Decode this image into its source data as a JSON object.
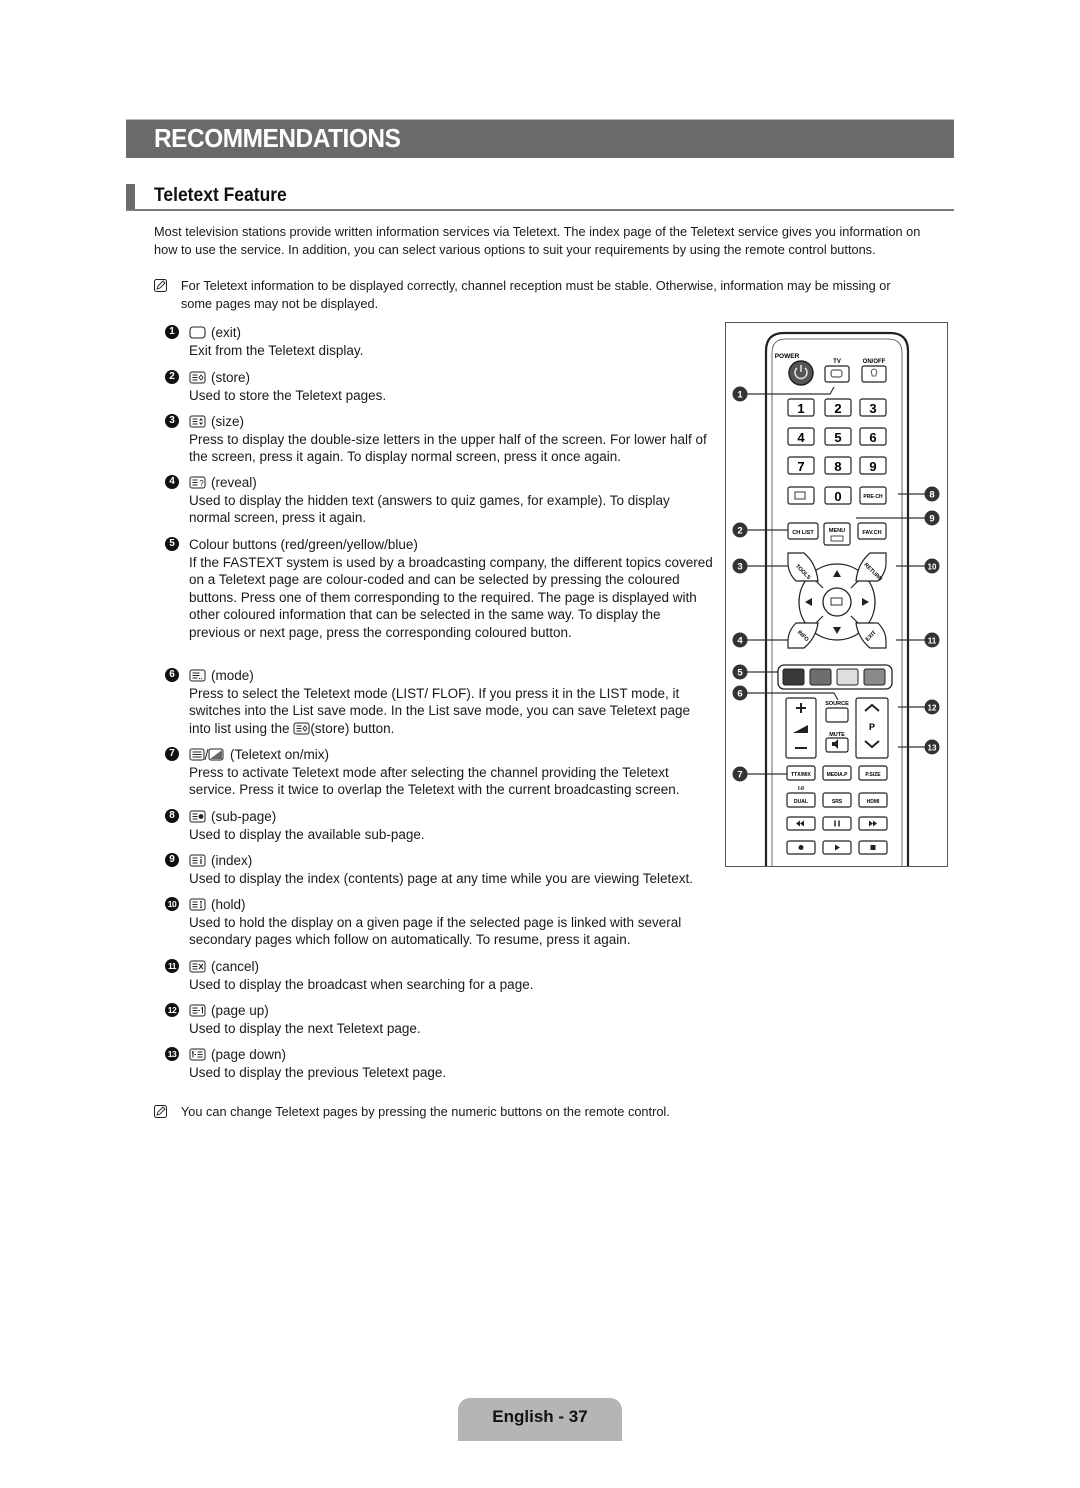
{
  "banner": {
    "title": "RECOMMENDATIONS"
  },
  "section": {
    "title": "Teletext Feature"
  },
  "intro": "Most television stations provide written information services via Teletext. The index page of the Teletext service gives you information on how to use the service. In addition, you can select various options to suit your requirements by using the remote control buttons.",
  "notes": [
    {
      "icon": "note-icon",
      "text": "For Teletext information to be displayed correctly, channel reception must be stable. Otherwise, information may be missing or some pages may not be displayed."
    },
    {
      "icon": "note-icon",
      "text": "You can change Teletext pages by pressing the numeric buttons on the remote control."
    }
  ],
  "items": [
    {
      "number": "1",
      "icon": "exit-icon",
      "label": "(exit)",
      "description": "Exit from the Teletext display."
    },
    {
      "number": "2",
      "icon": "store-icon",
      "label": "(store)",
      "description": "Used to store the Teletext pages."
    },
    {
      "number": "3",
      "icon": "size-icon",
      "label": "(size)",
      "description": "Press to display the double-size letters in the upper half of the screen. For lower half of the screen, press it again. To display normal screen, press it once again."
    },
    {
      "number": "4",
      "icon": "reveal-icon",
      "label": "(reveal)",
      "description": "Used to display the hidden text (answers to quiz games, for example). To display normal screen, press it again."
    },
    {
      "number": "5",
      "icon": "",
      "label": "Colour buttons (red/green/yellow/blue)",
      "description": "If the FASTEXT system is used by a broadcasting company, the different topics covered on a Teletext page are colour-coded and can be selected by pressing the coloured buttons. Press one of them corresponding to the required. The page is displayed with other coloured information that can be selected in the same way. To display the previous or next page, press the corresponding coloured button."
    },
    {
      "number": "6",
      "icon": "mode-icon",
      "label": "(mode)",
      "description_before": "Press to select the Teletext mode (LIST/ FLOF). If you press it in the LIST mode, it switches into the List save mode. In the List save mode, you can save Teletext page into list using the ",
      "description_after": "(store) button."
    },
    {
      "number": "7",
      "icon": "teletext-mix-icon",
      "label": "(Teletext on/mix)",
      "description": "Press to activate Teletext mode after selecting the channel providing the Teletext service. Press it twice to overlap the Teletext with the current broadcasting screen."
    },
    {
      "number": "8",
      "icon": "sub-page-icon",
      "label": "(sub-page)",
      "description": "Used to display the available sub-page."
    },
    {
      "number": "9",
      "icon": "index-icon",
      "label": "(index)",
      "description": "Used to display the index (contents) page at any time while you are viewing Teletext."
    },
    {
      "number": "10",
      "icon": "hold-icon",
      "label": "(hold)",
      "description": "Used to hold the display on a given page if the selected page is linked with several secondary pages which follow on automatically. To resume, press it again."
    },
    {
      "number": "11",
      "icon": "cancel-icon",
      "label": "(cancel)",
      "description": "Used to display the broadcast when searching for a page."
    },
    {
      "number": "12",
      "icon": "page-up-icon",
      "label": "(page up)",
      "description": "Used to display the next Teletext page."
    },
    {
      "number": "13",
      "icon": "page-down-icon",
      "label": "(page down)",
      "description": "Used to display the previous Teletext page."
    }
  ],
  "remote": {
    "power_label": "POWER",
    "tv_label": "TV",
    "onoff_label": "ON/OFF",
    "digits": [
      "1",
      "2",
      "3",
      "4",
      "5",
      "6",
      "7",
      "8",
      "9"
    ],
    "zero": "0",
    "prech": "PRE-CH",
    "chlist": "CH LIST",
    "menu": "MENU",
    "favch": "FAV.CH",
    "tools": "TOOLS",
    "return": "RETURN",
    "info": "INFO",
    "exit": "EXIT",
    "source": "SOURCE",
    "mute": "MUTE",
    "p": "P",
    "ttxmix": "TTX/MIX",
    "mediap": "MEDIA.P",
    "psize": "P.SIZE",
    "dual_top": "I-II",
    "dual": "DUAL",
    "srs": "SRS",
    "hdmi": "HDMI",
    "colour_buttons": [
      "#3a3a3a",
      "#6e6e6e",
      "#dedede",
      "#8a8a8a"
    ],
    "callouts_left": [
      "1",
      "2",
      "3",
      "4",
      "5",
      "6",
      "7"
    ],
    "callouts_right": [
      "8",
      "9",
      "10",
      "11",
      "12",
      "13"
    ]
  },
  "footer": {
    "page_label": "English - 37"
  }
}
